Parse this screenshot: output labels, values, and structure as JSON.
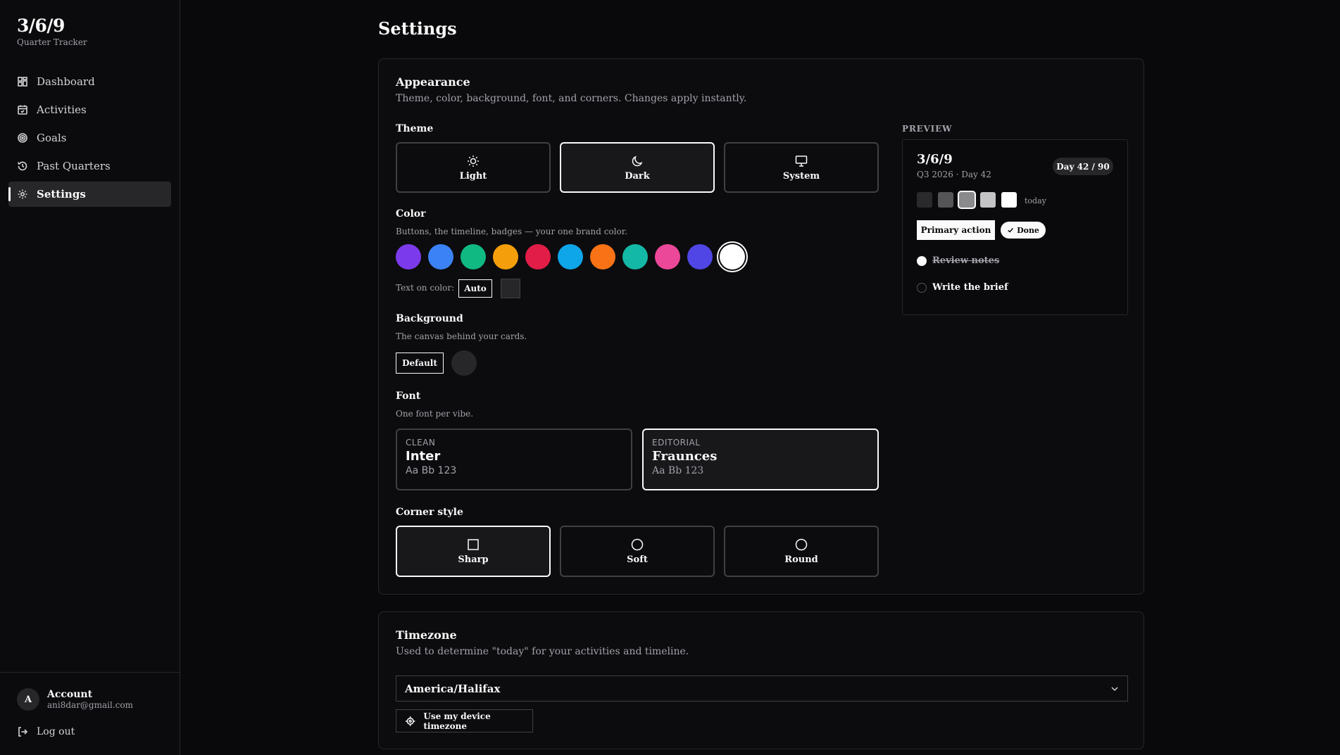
{
  "brand": {
    "title": "3/6/9",
    "subtitle": "Quarter Tracker"
  },
  "nav": [
    {
      "label": "Dashboard",
      "icon": "dashboard-icon"
    },
    {
      "label": "Activities",
      "icon": "calendar-icon"
    },
    {
      "label": "Goals",
      "icon": "target-icon"
    },
    {
      "label": "Past Quarters",
      "icon": "history-icon"
    },
    {
      "label": "Settings",
      "icon": "gear-icon",
      "active": true
    }
  ],
  "account": {
    "avatar": "A",
    "label": "Account",
    "email": "ani8dar@gmail.com",
    "logout": "Log out"
  },
  "page_title": "Settings",
  "appearance": {
    "title": "Appearance",
    "subtitle": "Theme, color, background, font, and corners. Changes apply instantly.",
    "theme": {
      "label": "Theme",
      "options": [
        {
          "label": "Light",
          "icon": "sun-icon"
        },
        {
          "label": "Dark",
          "icon": "moon-icon",
          "selected": true
        },
        {
          "label": "System",
          "icon": "monitor-icon"
        }
      ]
    },
    "color": {
      "label": "Color",
      "hint": "Buttons, the timeline, badges — your one brand color.",
      "swatches": [
        "#7c3aed",
        "#3b82f6",
        "#10b981",
        "#f59e0b",
        "#e11d48",
        "#0ea5e9",
        "#f97316",
        "#14b8a6",
        "#ec4899",
        "#4f46e5",
        "#ffffff"
      ],
      "selected_index": 10,
      "text_on_color_label": "Text on color:",
      "text_on_color_value": "Auto"
    },
    "background": {
      "label": "Background",
      "hint": "The canvas behind your cards.",
      "default_label": "Default"
    },
    "font": {
      "label": "Font",
      "hint": "One font per vibe.",
      "options": [
        {
          "kind": "CLEAN",
          "name": "Inter",
          "sample": "Aa Bb 123"
        },
        {
          "kind": "EDITORIAL",
          "name": "Fraunces",
          "sample": "Aa Bb 123",
          "selected": true
        }
      ]
    },
    "corners": {
      "label": "Corner style",
      "options": [
        {
          "label": "Sharp",
          "icon": "square-icon",
          "selected": true
        },
        {
          "label": "Soft",
          "icon": "circle-icon"
        },
        {
          "label": "Round",
          "icon": "circle-icon"
        }
      ]
    },
    "preview": {
      "label": "PREVIEW",
      "title": "3/6/9",
      "subtitle": "Q3 2026 · Day 42",
      "badge": "Day 42 / 90",
      "scale_colors": [
        "#2a2a2d",
        "#555558",
        "#8a8a8d",
        "#c4c4c6",
        "#ffffff"
      ],
      "today_label": "today",
      "primary_action": "Primary action",
      "done": "Done",
      "tasks": [
        {
          "label": "Review notes",
          "done": true
        },
        {
          "label": "Write the brief",
          "done": false
        }
      ]
    }
  },
  "timezone": {
    "title": "Timezone",
    "subtitle": "Used to determine \"today\" for your activities and timeline.",
    "value": "America/Halifax",
    "device_button": "Use my device timezone"
  }
}
